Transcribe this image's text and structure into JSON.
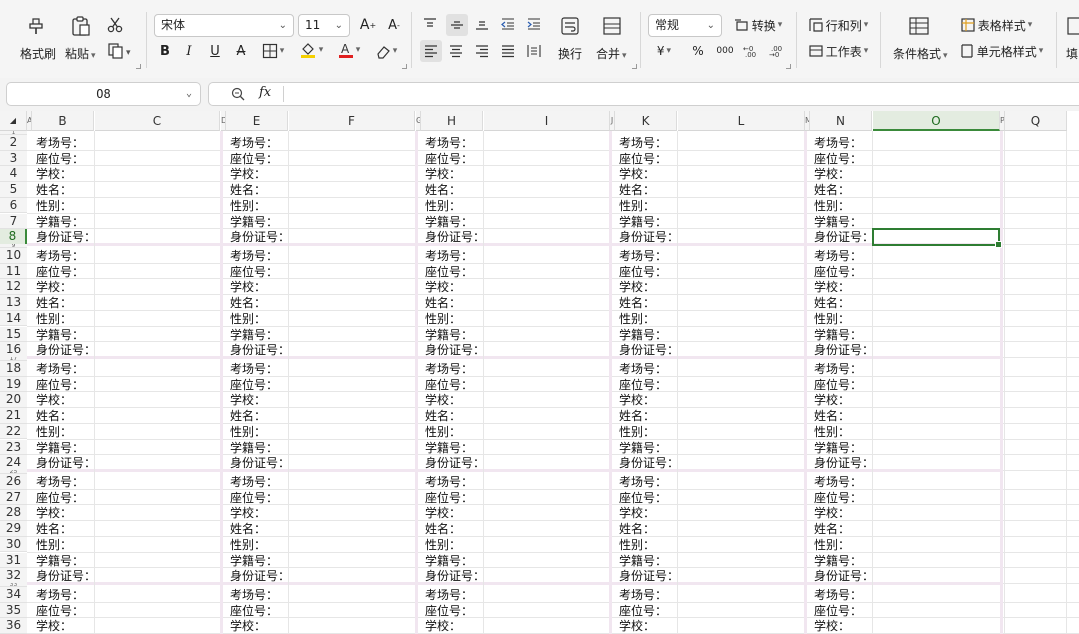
{
  "ribbon": {
    "format_painter": "格式刷",
    "paste": "粘贴",
    "font_name": "宋体",
    "font_size": "11",
    "bold": "B",
    "italic": "I",
    "underline": "U",
    "strike": "A",
    "font_color_a": "A",
    "wrap": "换行",
    "merge": "合并",
    "number_format": "常规",
    "convert": "转换",
    "rows_cols": "行和列",
    "worksheet": "工作表",
    "cond_format": "条件格式",
    "table_style": "表格样式",
    "cell_style": "单元格样式",
    "fill": "填",
    "currency": "¥",
    "percent": "%",
    "thousands": "000"
  },
  "colors": {
    "accent_green": "#2e7d32",
    "font_red": "#e02020",
    "fill_yellow": "#f5d000"
  },
  "formula": {
    "name_box": "O8",
    "fx": "fx",
    "content": ""
  },
  "columns": [
    "B",
    "C",
    "E",
    "F",
    "H",
    "I",
    "K",
    "L",
    "N",
    "O",
    "P",
    "Q"
  ],
  "column_markers": [
    "A",
    "D",
    "G",
    "J",
    "M"
  ],
  "rows": [
    "2",
    "3",
    "4",
    "5",
    "6",
    "7",
    "8",
    "10",
    "11",
    "12",
    "13",
    "14",
    "15",
    "16",
    "18",
    "19",
    "20",
    "21",
    "22",
    "23",
    "24",
    "26",
    "27",
    "28",
    "29",
    "30",
    "31",
    "32",
    "34",
    "35",
    "36"
  ],
  "row_markers": [
    "1",
    "9",
    "17",
    "25",
    "33"
  ],
  "field_labels": [
    "考场号：",
    "座位号：",
    "学校：",
    "姓名：",
    "性别：",
    "学籍号：",
    "身份证号："
  ],
  "selected_cell": "O8"
}
